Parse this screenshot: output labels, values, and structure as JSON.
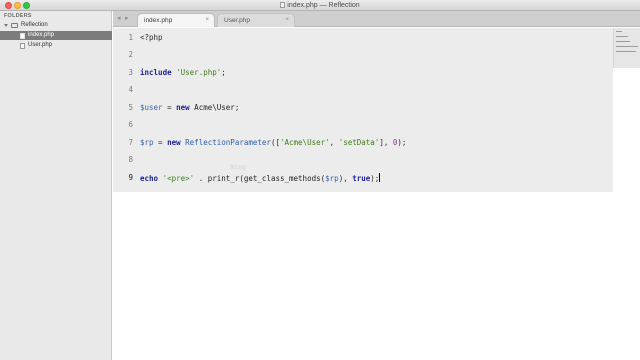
{
  "window": {
    "title": "index.php — Reflection"
  },
  "sidebar": {
    "heading": "FOLDERS",
    "folder": {
      "label": "Reflection",
      "icon": "folder-icon"
    },
    "files": [
      {
        "label": "index.php",
        "active": true
      },
      {
        "label": "User.php",
        "active": false
      }
    ]
  },
  "tabs": {
    "nav_left": "◂",
    "nav_right": "▸",
    "items": [
      {
        "label": "index.php",
        "active": true,
        "close": "×"
      },
      {
        "label": "User.php",
        "active": false,
        "close": "×"
      }
    ]
  },
  "editor": {
    "gutter": [
      "1",
      "2",
      "3",
      "4",
      "5",
      "6",
      "7",
      "8",
      "9"
    ],
    "current_line": "9",
    "ghost_text": "Bing",
    "lines": {
      "l1": "<?php",
      "l3_kw": "include",
      "l3_str": "'User.php'",
      "l3_end": ";",
      "l5_var": "$user",
      "l5_eq": " = ",
      "l5_kw": "new",
      "l5_cls": " Acme\\User",
      "l5_end": ";",
      "l7_var": "$rp",
      "l7_eq": " = ",
      "l7_kw": "new",
      "l7_cls": " ReflectionParameter",
      "l7_open": "([",
      "l7_str1": "'Acme\\User'",
      "l7_comma": ", ",
      "l7_str2": "'setData'",
      "l7_mid": "], ",
      "l7_num": "0",
      "l7_end": ");",
      "l9_kw": "echo",
      "l9_sp": " ",
      "l9_str": "'<pre>'",
      "l9_dot": " . ",
      "l9_fn": "print_r(get_class_methods(",
      "l9_var": "$rp",
      "l9_comma": "), ",
      "l9_true": "true",
      "l9_end": ");"
    }
  },
  "colors": {
    "keyword": "#1d1d9a",
    "string": "#3f7b1a",
    "variable": "#3b5ea8",
    "number": "#8a3b8a",
    "active_file_bg": "#7c7c7c"
  }
}
